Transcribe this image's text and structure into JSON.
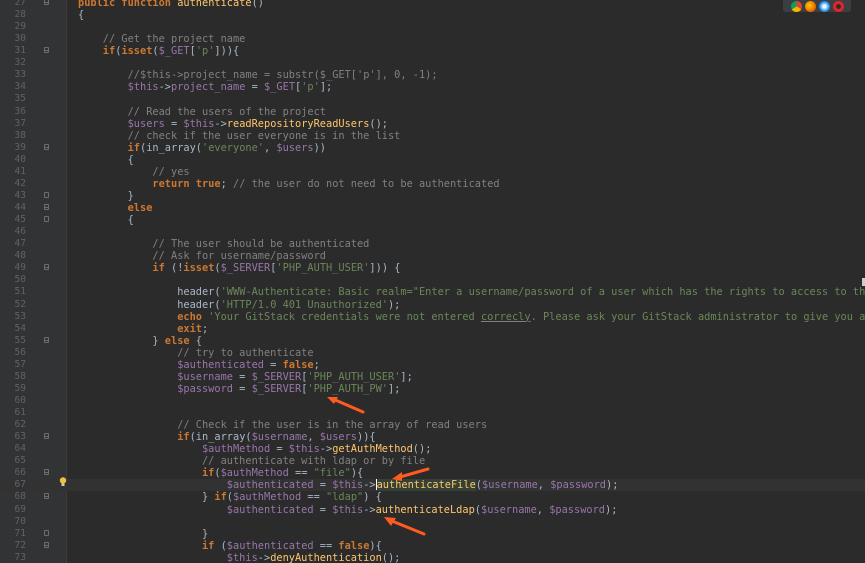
{
  "colors": {
    "background": "#2b2b2b",
    "keyword": "#cc7832",
    "variable": "#9876aa",
    "function": "#ffc66d",
    "string": "#6a8759",
    "comment": "#808080",
    "text": "#a9b7c6",
    "arrow": "#ff5a1f"
  },
  "browser_icons": [
    "chrome-icon",
    "firefox-icon",
    "safari-icon",
    "opera-icon"
  ],
  "line_numbers": [
    "27",
    "28",
    "29",
    "30",
    "31",
    "32",
    "33",
    "34",
    "35",
    "36",
    "37",
    "38",
    "39",
    "40",
    "41",
    "42",
    "43",
    "44",
    "45",
    "46",
    "47",
    "48",
    "49",
    "50",
    "51",
    "52",
    "53",
    "54",
    "55",
    "56",
    "57",
    "58",
    "59",
    "60",
    "61",
    "62",
    "63",
    "64",
    "65",
    "66",
    "67",
    "68",
    "69",
    "70",
    "71",
    "72",
    "73"
  ],
  "lines": [
    [
      [
        "k",
        "public function "
      ],
      [
        "f",
        "authenticate"
      ],
      [
        "p",
        "()"
      ]
    ],
    [
      [
        "p",
        "{"
      ]
    ],
    [],
    [
      [
        "c",
        "    // Get the project name"
      ]
    ],
    [
      [
        "k",
        "    if"
      ],
      [
        "p",
        "("
      ],
      [
        "k",
        "isset"
      ],
      [
        "p",
        "("
      ],
      [
        "v",
        "$_GET"
      ],
      [
        "p",
        "["
      ],
      [
        "s",
        "'p'"
      ],
      [
        "p",
        "])){"
      ]
    ],
    [],
    [
      [
        "c",
        "        //$this->project_name = "
      ],
      [
        "c",
        "substr"
      ],
      [
        "c",
        "($_GET['p'], 0, -1);"
      ]
    ],
    [
      [
        "v",
        "        $this"
      ],
      [
        "p",
        "->"
      ],
      [
        "v",
        "project_name"
      ],
      [
        "p",
        " = "
      ],
      [
        "v",
        "$_GET"
      ],
      [
        "p",
        "["
      ],
      [
        "s",
        "'p'"
      ],
      [
        "p",
        "];"
      ]
    ],
    [],
    [
      [
        "c",
        "        // Read the users of the project"
      ]
    ],
    [
      [
        "v",
        "        $users"
      ],
      [
        "p",
        " = "
      ],
      [
        "v",
        "$this"
      ],
      [
        "p",
        "->"
      ],
      [
        "f",
        "readRepositoryReadUsers"
      ],
      [
        "p",
        "();"
      ]
    ],
    [
      [
        "c",
        "        // check if the user everyone is in the list"
      ]
    ],
    [
      [
        "k",
        "        if"
      ],
      [
        "p",
        "(in_array("
      ],
      [
        "s",
        "'everyone'"
      ],
      [
        "p",
        ", "
      ],
      [
        "v",
        "$users"
      ],
      [
        "p",
        "))"
      ]
    ],
    [
      [
        "p",
        "        {"
      ]
    ],
    [
      [
        "c",
        "            // yes"
      ]
    ],
    [
      [
        "k",
        "            return true"
      ],
      [
        "p",
        "; "
      ],
      [
        "c",
        "// the user do not need to be authenticated"
      ]
    ],
    [
      [
        "p",
        "        }"
      ]
    ],
    [
      [
        "k",
        "        else"
      ]
    ],
    [
      [
        "p",
        "        {"
      ]
    ],
    [],
    [
      [
        "c",
        "            // The user should be authenticated"
      ]
    ],
    [
      [
        "c",
        "            // Ask for username/password"
      ]
    ],
    [
      [
        "k",
        "            if "
      ],
      [
        "p",
        "(!"
      ],
      [
        "k",
        "isset"
      ],
      [
        "p",
        "("
      ],
      [
        "v",
        "$_SERVER"
      ],
      [
        "p",
        "["
      ],
      [
        "s",
        "'PHP_AUTH_USER'"
      ],
      [
        "p",
        "])) {"
      ]
    ],
    [],
    [
      [
        "p",
        "                header("
      ],
      [
        "s",
        "'WWW-Authenticate: Basic realm=\"Enter a username/password of a user which has the rights to access to this repositor"
      ]
    ],
    [
      [
        "p",
        "                header("
      ],
      [
        "s",
        "'HTTP/1.0 401 Unauthorized'"
      ],
      [
        "p",
        ");"
      ]
    ],
    [
      [
        "k",
        "                echo "
      ],
      [
        "s",
        "'Your GitStack credentials were not entered "
      ],
      [
        "u",
        "correcly"
      ],
      [
        "s",
        ". Please ask your GitStack administrator to give you a username/pa"
      ]
    ],
    [
      [
        "k",
        "                exit"
      ],
      [
        "p",
        ";"
      ]
    ],
    [
      [
        "p",
        "            } "
      ],
      [
        "k",
        "else "
      ],
      [
        "p",
        "{"
      ]
    ],
    [
      [
        "c",
        "                // try to authenticate"
      ]
    ],
    [
      [
        "v",
        "                $authenticated"
      ],
      [
        "p",
        " = "
      ],
      [
        "k",
        "false"
      ],
      [
        "p",
        ";"
      ]
    ],
    [
      [
        "v",
        "                $username"
      ],
      [
        "p",
        " = "
      ],
      [
        "v",
        "$_SERVER"
      ],
      [
        "p",
        "["
      ],
      [
        "s",
        "'PHP_AUTH_USER'"
      ],
      [
        "p",
        "];"
      ]
    ],
    [
      [
        "v",
        "                $password"
      ],
      [
        "p",
        " = "
      ],
      [
        "v",
        "$_SERVER"
      ],
      [
        "p",
        "["
      ],
      [
        "s",
        "'PHP_AUTH_PW'"
      ],
      [
        "p",
        "];"
      ]
    ],
    [],
    [],
    [
      [
        "c",
        "                // Check if the user is in the array of read users"
      ]
    ],
    [
      [
        "k",
        "                if"
      ],
      [
        "p",
        "(in_array("
      ],
      [
        "v",
        "$username"
      ],
      [
        "p",
        ", "
      ],
      [
        "v",
        "$users"
      ],
      [
        "p",
        ")){"
      ]
    ],
    [
      [
        "v",
        "                    $authMethod"
      ],
      [
        "p",
        " = "
      ],
      [
        "v",
        "$this"
      ],
      [
        "p",
        "->"
      ],
      [
        "f",
        "getAuthMethod"
      ],
      [
        "p",
        "();"
      ]
    ],
    [
      [
        "c",
        "                    // authenticate with ldap or by file"
      ]
    ],
    [
      [
        "k",
        "                    if"
      ],
      [
        "p",
        "("
      ],
      [
        "v",
        "$authMethod"
      ],
      [
        "p",
        " == "
      ],
      [
        "s",
        "\"file\""
      ],
      [
        "p",
        "){"
      ]
    ],
    [
      [
        "v",
        "                        $authenticated"
      ],
      [
        "p",
        " = "
      ],
      [
        "v",
        "$this"
      ],
      [
        "p",
        "->"
      ],
      [
        "caret",
        ""
      ],
      [
        "sel",
        "authenticateFile"
      ],
      [
        "p",
        "("
      ],
      [
        "v",
        "$username"
      ],
      [
        "p",
        ", "
      ],
      [
        "v",
        "$password"
      ],
      [
        "p",
        ");"
      ]
    ],
    [
      [
        "p",
        "                    } "
      ],
      [
        "k",
        "if"
      ],
      [
        "p",
        "("
      ],
      [
        "v",
        "$authMethod"
      ],
      [
        "p",
        " == "
      ],
      [
        "s",
        "\"ldap\""
      ],
      [
        "p",
        ") {"
      ]
    ],
    [
      [
        "v",
        "                        $authenticated"
      ],
      [
        "p",
        " = "
      ],
      [
        "v",
        "$this"
      ],
      [
        "p",
        "->"
      ],
      [
        "f",
        "authenticateLdap"
      ],
      [
        "p",
        "("
      ],
      [
        "v",
        "$username"
      ],
      [
        "p",
        ", "
      ],
      [
        "v",
        "$password"
      ],
      [
        "p",
        ");"
      ]
    ],
    [],
    [
      [
        "p",
        "                    }"
      ]
    ],
    [
      [
        "k",
        "                    if "
      ],
      [
        "p",
        "("
      ],
      [
        "v",
        "$authenticated"
      ],
      [
        "p",
        " == "
      ],
      [
        "k",
        "false"
      ],
      [
        "p",
        "){"
      ]
    ],
    [
      [
        "v",
        "                        $this"
      ],
      [
        "p",
        "->"
      ],
      [
        "f",
        "denyAuthentication"
      ],
      [
        "p",
        "();"
      ]
    ]
  ],
  "folds": {
    "27": "open",
    "31": "open",
    "39": "open",
    "43": "close",
    "44": "open",
    "45": "close",
    "49": "open",
    "55": "open",
    "63": "open",
    "66": "open",
    "68": "open",
    "71": "close",
    "72": "open"
  }
}
